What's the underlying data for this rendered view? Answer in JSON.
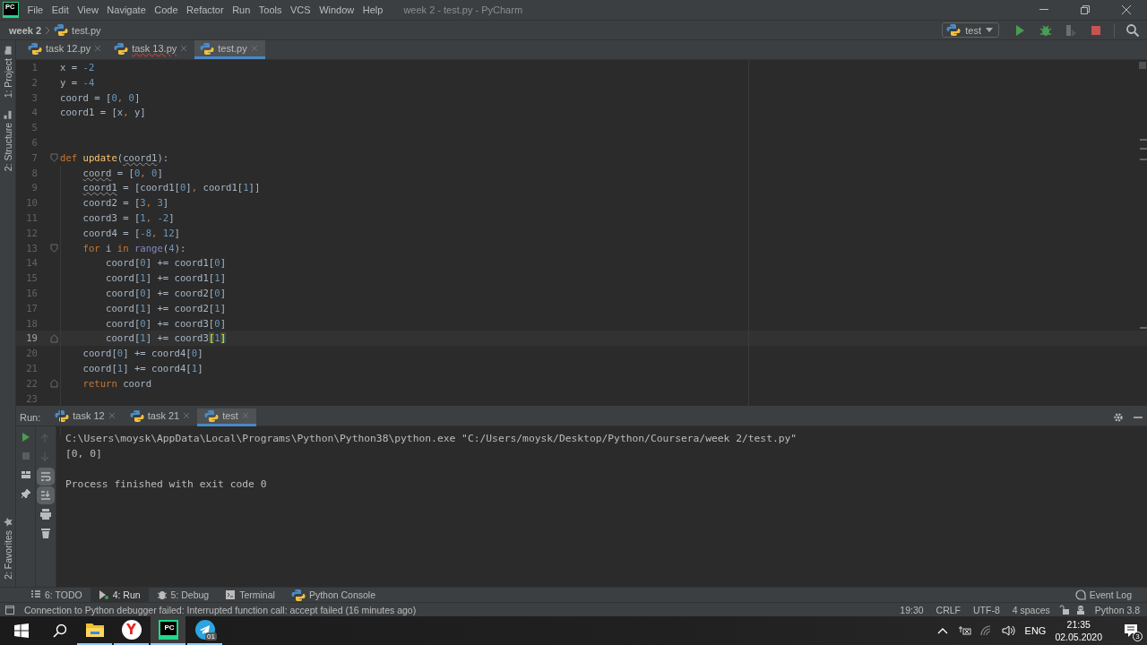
{
  "window": {
    "logo": "PC",
    "title": "week 2 - test.py - PyCharm"
  },
  "menu": [
    "File",
    "Edit",
    "View",
    "Navigate",
    "Code",
    "Refactor",
    "Run",
    "Tools",
    "VCS",
    "Window",
    "Help"
  ],
  "breadcrumb": [
    "week 2",
    "test.py"
  ],
  "run_config": {
    "label": "test"
  },
  "tool_strip": {
    "top": [
      "1: Project",
      "2: Structure"
    ],
    "bottom": [
      "2: Favorites"
    ]
  },
  "editor_tabs": [
    {
      "label": "task 12.py",
      "selected": false,
      "error": false
    },
    {
      "label": "task 13.py",
      "selected": false,
      "error": true
    },
    {
      "label": "test.py",
      "selected": true,
      "error": false
    }
  ],
  "code": [
    {
      "number": "1",
      "current": false,
      "fold_start": false,
      "fold_end": false,
      "tokens": [
        {
          "text": "x = ",
          "kind": "plain"
        },
        {
          "text": "-2",
          "kind": "number"
        }
      ]
    },
    {
      "number": "2",
      "current": false,
      "fold_start": false,
      "fold_end": false,
      "tokens": [
        {
          "text": "y = ",
          "kind": "plain"
        },
        {
          "text": "-4",
          "kind": "number"
        }
      ]
    },
    {
      "number": "3",
      "current": false,
      "fold_start": false,
      "fold_end": false,
      "tokens": [
        {
          "text": "coord = [",
          "kind": "plain"
        },
        {
          "text": "0",
          "kind": "number"
        },
        {
          "text": ",",
          "kind": "comma"
        },
        {
          "text": " 0",
          "kind": "number"
        },
        {
          "text": "]",
          "kind": "plain"
        }
      ]
    },
    {
      "number": "4",
      "current": false,
      "fold_start": false,
      "fold_end": false,
      "tokens": [
        {
          "text": "coord1 = [x",
          "kind": "plain"
        },
        {
          "text": ",",
          "kind": "comma"
        },
        {
          "text": " y]",
          "kind": "plain"
        }
      ]
    },
    {
      "number": "5",
      "current": false,
      "fold_start": false,
      "fold_end": false
    },
    {
      "number": "6",
      "current": false,
      "fold_start": false,
      "fold_end": false
    },
    {
      "number": "7",
      "current": false,
      "fold_start": true,
      "fold_end": false,
      "tokens": [
        {
          "text": "def",
          "kind": "keyword"
        },
        {
          "text": " update",
          "kind": "function"
        },
        {
          "text": "(",
          "kind": "plain"
        },
        {
          "text": "coord1",
          "kind": "warning"
        },
        {
          "text": "):",
          "kind": "plain"
        }
      ]
    },
    {
      "number": "8",
      "current": false,
      "fold_start": false,
      "fold_end": false,
      "tokens": [
        {
          "text": "    coord",
          "kind": "warning"
        },
        {
          "text": " = [",
          "kind": "plain"
        },
        {
          "text": "0",
          "kind": "number"
        },
        {
          "text": ",",
          "kind": "comma"
        },
        {
          "text": " 0",
          "kind": "number"
        },
        {
          "text": "]",
          "kind": "plain"
        }
      ]
    },
    {
      "number": "9",
      "current": false,
      "fold_start": false,
      "fold_end": false,
      "tokens": [
        {
          "text": "    coord1",
          "kind": "warning"
        },
        {
          "text": " = [coord1[",
          "kind": "plain"
        },
        {
          "text": "0",
          "kind": "number"
        },
        {
          "text": "]",
          "kind": "plain"
        },
        {
          "text": ",",
          "kind": "comma"
        },
        {
          "text": " coord1[",
          "kind": "plain"
        },
        {
          "text": "1",
          "kind": "number"
        },
        {
          "text": "]]",
          "kind": "plain"
        }
      ]
    },
    {
      "number": "10",
      "current": false,
      "fold_start": false,
      "fold_end": false,
      "tokens": [
        {
          "text": "    coord2 = [",
          "kind": "plain"
        },
        {
          "text": "3",
          "kind": "number"
        },
        {
          "text": ",",
          "kind": "comma"
        },
        {
          "text": " 3",
          "kind": "number"
        },
        {
          "text": "]",
          "kind": "plain"
        }
      ]
    },
    {
      "number": "11",
      "current": false,
      "fold_start": false,
      "fold_end": false,
      "tokens": [
        {
          "text": "    coord3 = [",
          "kind": "plain"
        },
        {
          "text": "1",
          "kind": "number"
        },
        {
          "text": ",",
          "kind": "comma"
        },
        {
          "text": " -2",
          "kind": "number"
        },
        {
          "text": "]",
          "kind": "plain"
        }
      ]
    },
    {
      "number": "12",
      "current": false,
      "fold_start": false,
      "fold_end": false,
      "tokens": [
        {
          "text": "    coord4 = [",
          "kind": "plain"
        },
        {
          "text": "-8",
          "kind": "number"
        },
        {
          "text": ",",
          "kind": "comma"
        },
        {
          "text": " 12",
          "kind": "number"
        },
        {
          "text": "]",
          "kind": "plain"
        }
      ]
    },
    {
      "number": "13",
      "current": false,
      "fold_start": true,
      "fold_end": false,
      "tokens": [
        {
          "text": "    for",
          "kind": "keyword"
        },
        {
          "text": " i ",
          "kind": "plain"
        },
        {
          "text": "in",
          "kind": "keyword"
        },
        {
          "text": " range",
          "kind": "builtin"
        },
        {
          "text": "(",
          "kind": "plain"
        },
        {
          "text": "4",
          "kind": "number"
        },
        {
          "text": "):",
          "kind": "plain"
        }
      ]
    },
    {
      "number": "14",
      "current": false,
      "fold_start": false,
      "fold_end": false,
      "tokens": [
        {
          "text": "        coord[",
          "kind": "plain"
        },
        {
          "text": "0",
          "kind": "number"
        },
        {
          "text": "] += coord1[",
          "kind": "plain"
        },
        {
          "text": "0",
          "kind": "number"
        },
        {
          "text": "]",
          "kind": "plain"
        }
      ]
    },
    {
      "number": "15",
      "current": false,
      "fold_start": false,
      "fold_end": false,
      "tokens": [
        {
          "text": "        coord[",
          "kind": "plain"
        },
        {
          "text": "1",
          "kind": "number"
        },
        {
          "text": "] += coord1[",
          "kind": "plain"
        },
        {
          "text": "1",
          "kind": "number"
        },
        {
          "text": "]",
          "kind": "plain"
        }
      ]
    },
    {
      "number": "16",
      "current": false,
      "fold_start": false,
      "fold_end": false,
      "tokens": [
        {
          "text": "        coord[",
          "kind": "plain"
        },
        {
          "text": "0",
          "kind": "number"
        },
        {
          "text": "] += coord2[",
          "kind": "plain"
        },
        {
          "text": "0",
          "kind": "number"
        },
        {
          "text": "]",
          "kind": "plain"
        }
      ]
    },
    {
      "number": "17",
      "current": false,
      "fold_start": false,
      "fold_end": false,
      "tokens": [
        {
          "text": "        coord[",
          "kind": "plain"
        },
        {
          "text": "1",
          "kind": "number"
        },
        {
          "text": "] += coord2[",
          "kind": "plain"
        },
        {
          "text": "1",
          "kind": "number"
        },
        {
          "text": "]",
          "kind": "plain"
        }
      ]
    },
    {
      "number": "18",
      "current": false,
      "fold_start": false,
      "fold_end": false,
      "tokens": [
        {
          "text": "        coord[",
          "kind": "plain"
        },
        {
          "text": "0",
          "kind": "number"
        },
        {
          "text": "] += coord3[",
          "kind": "plain"
        },
        {
          "text": "0",
          "kind": "number"
        },
        {
          "text": "]",
          "kind": "plain"
        }
      ]
    },
    {
      "number": "19",
      "current": true,
      "fold_start": false,
      "fold_end": true,
      "tokens": [
        {
          "text": "        coord[",
          "kind": "plain"
        },
        {
          "text": "1",
          "kind": "number"
        },
        {
          "text": "] += coord3",
          "kind": "plain"
        },
        {
          "text": "[",
          "kind": "match"
        },
        {
          "text": "1",
          "kind": "number"
        },
        {
          "text": "]",
          "kind": "match"
        }
      ]
    },
    {
      "number": "20",
      "current": false,
      "fold_start": false,
      "fold_end": false,
      "tokens": [
        {
          "text": "    coord[",
          "kind": "plain"
        },
        {
          "text": "0",
          "kind": "number"
        },
        {
          "text": "] += coord4[",
          "kind": "plain"
        },
        {
          "text": "0",
          "kind": "number"
        },
        {
          "text": "]",
          "kind": "plain"
        }
      ]
    },
    {
      "number": "21",
      "current": false,
      "fold_start": false,
      "fold_end": false,
      "tokens": [
        {
          "text": "    coord[",
          "kind": "plain"
        },
        {
          "text": "1",
          "kind": "number"
        },
        {
          "text": "] += coord4[",
          "kind": "plain"
        },
        {
          "text": "1",
          "kind": "number"
        },
        {
          "text": "]",
          "kind": "plain"
        }
      ]
    },
    {
      "number": "22",
      "current": false,
      "fold_start": false,
      "fold_end": true,
      "tokens": [
        {
          "text": "    return",
          "kind": "keyword"
        },
        {
          "text": " coord",
          "kind": "plain"
        }
      ]
    },
    {
      "number": "23",
      "current": false,
      "fold_start": false,
      "fold_end": false
    }
  ],
  "run_panel": {
    "title": "Run:",
    "tabs": [
      {
        "label": "task 12",
        "selected": false
      },
      {
        "label": "task 21",
        "selected": false
      },
      {
        "label": "test",
        "selected": true
      }
    ],
    "console": [
      {
        "kind": "command",
        "text": "C:\\Users\\moysk\\AppData\\Local\\Programs\\Python\\Python38\\python.exe \"C:/Users/moysk/Desktop/Python/Coursera/week 2/test.py\""
      },
      {
        "kind": "output",
        "text": "[0, 0]"
      },
      {
        "kind": "exit",
        "text": "Process finished with exit code 0"
      }
    ]
  },
  "tool_tabs": [
    {
      "kind": "todo",
      "label": "6: TODO",
      "selected": false
    },
    {
      "kind": "run",
      "label": "4: Run",
      "selected": true
    },
    {
      "kind": "debug",
      "label": "5: Debug",
      "selected": false
    },
    {
      "kind": "terminal",
      "label": "Terminal",
      "selected": false
    },
    {
      "kind": "console",
      "label": "Python Console",
      "selected": false
    }
  ],
  "event_log": "Event Log",
  "status_bar": {
    "message": "Connection to Python debugger failed: Interrupted function call: accept failed (16 minutes ago)",
    "position": "19:30",
    "line_separator": "CRLF",
    "encoding": "UTF-8",
    "indent": "4 spaces",
    "interpreter": "Python 3.8"
  },
  "taskbar": {
    "apps": [
      {
        "kind": "explorer",
        "selected": false
      },
      {
        "kind": "browser",
        "letter": "Y",
        "selected": false
      },
      {
        "kind": "pycharm",
        "letter": "PC",
        "selected": true
      },
      {
        "kind": "telegram",
        "badge": "01",
        "selected": false
      }
    ],
    "language": "ENG",
    "time": "21:35",
    "date": "02.05.2020",
    "notifications": "3"
  }
}
